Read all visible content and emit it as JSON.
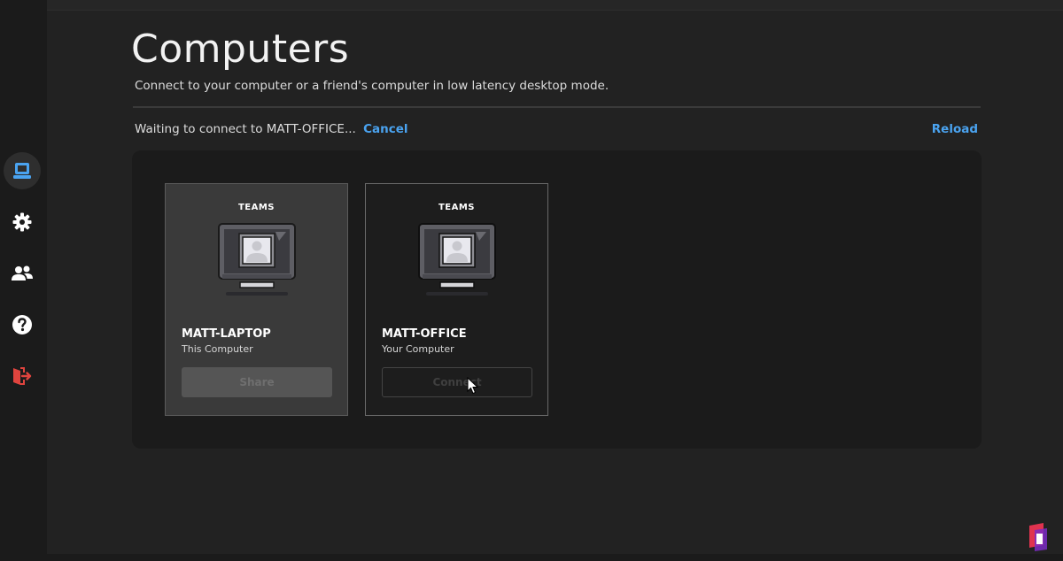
{
  "page": {
    "title": "Computers",
    "subtitle": "Connect to your computer or a friend's computer in low latency desktop mode."
  },
  "status": {
    "waiting_text": "Waiting to connect to MATT-OFFICE...",
    "cancel_label": "Cancel",
    "reload_label": "Reload"
  },
  "sidebar": {
    "items": [
      {
        "icon": "computer-icon",
        "active": true
      },
      {
        "icon": "gear-icon",
        "active": false
      },
      {
        "icon": "friends-icon",
        "active": false
      },
      {
        "icon": "help-icon",
        "active": false
      },
      {
        "icon": "logout-icon",
        "active": false
      }
    ]
  },
  "computers": [
    {
      "team": "TEAMS",
      "name": "MATT-LAPTOP",
      "description": "This Computer",
      "button_label": "Share",
      "button_state": "disabled"
    },
    {
      "team": "TEAMS",
      "name": "MATT-OFFICE",
      "description": "Your Computer",
      "button_label": "Connect",
      "button_state": "disabled"
    }
  ],
  "colors": {
    "background": "#222222",
    "sidebar": "#1b1b1b",
    "accent_blue": "#4aa3f0",
    "logout_red": "#e0443e",
    "panel": "#1b1b1b"
  }
}
